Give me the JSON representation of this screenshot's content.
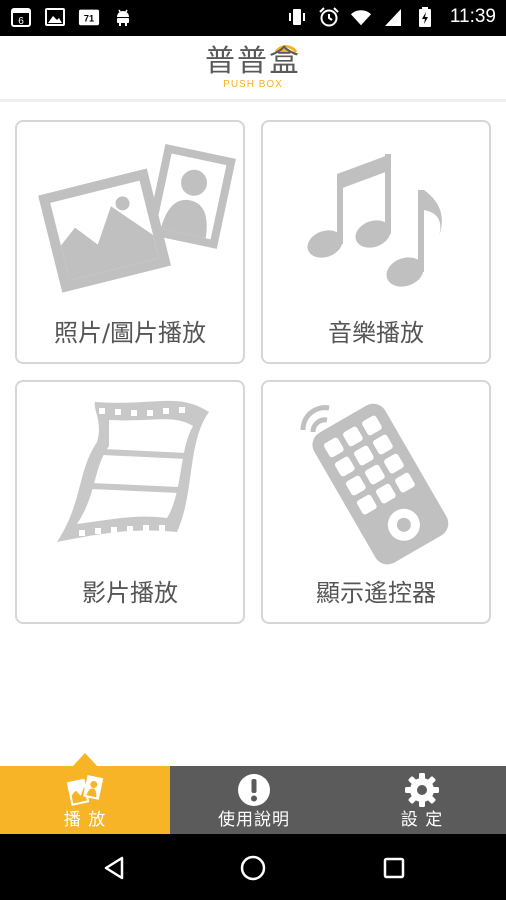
{
  "status_bar": {
    "time": "11:39",
    "calendar_day": "6",
    "notification_badge": "71",
    "left_icons": [
      "calendar-icon",
      "gallery-icon",
      "calendar-71-icon",
      "android-icon"
    ],
    "right_icons": [
      "vibrate-icon",
      "alarm-icon",
      "wifi-icon",
      "signal-icon",
      "battery-icon"
    ]
  },
  "header": {
    "logo_cn": "普普盒",
    "logo_en": "PUSH BOX",
    "accent_color": "#f5b21d"
  },
  "tiles": [
    {
      "label": "照片/圖片播放",
      "icon": "photos-icon"
    },
    {
      "label": "音樂播放",
      "icon": "music-notes-icon"
    },
    {
      "label": "影片播放",
      "icon": "film-strip-icon"
    },
    {
      "label": "顯示遙控器",
      "icon": "remote-control-icon"
    }
  ],
  "bottom_nav": {
    "active_color": "#f6b426",
    "bar_color": "#5b5b5b",
    "items": [
      {
        "label": "播 放",
        "icon": "play-cards-icon",
        "active": true
      },
      {
        "label": "使用說明",
        "icon": "info-exclamation-icon",
        "active": false
      },
      {
        "label": "設 定",
        "icon": "gear-icon",
        "active": false
      }
    ]
  },
  "system_nav": [
    "back-icon",
    "home-icon",
    "recents-icon"
  ]
}
